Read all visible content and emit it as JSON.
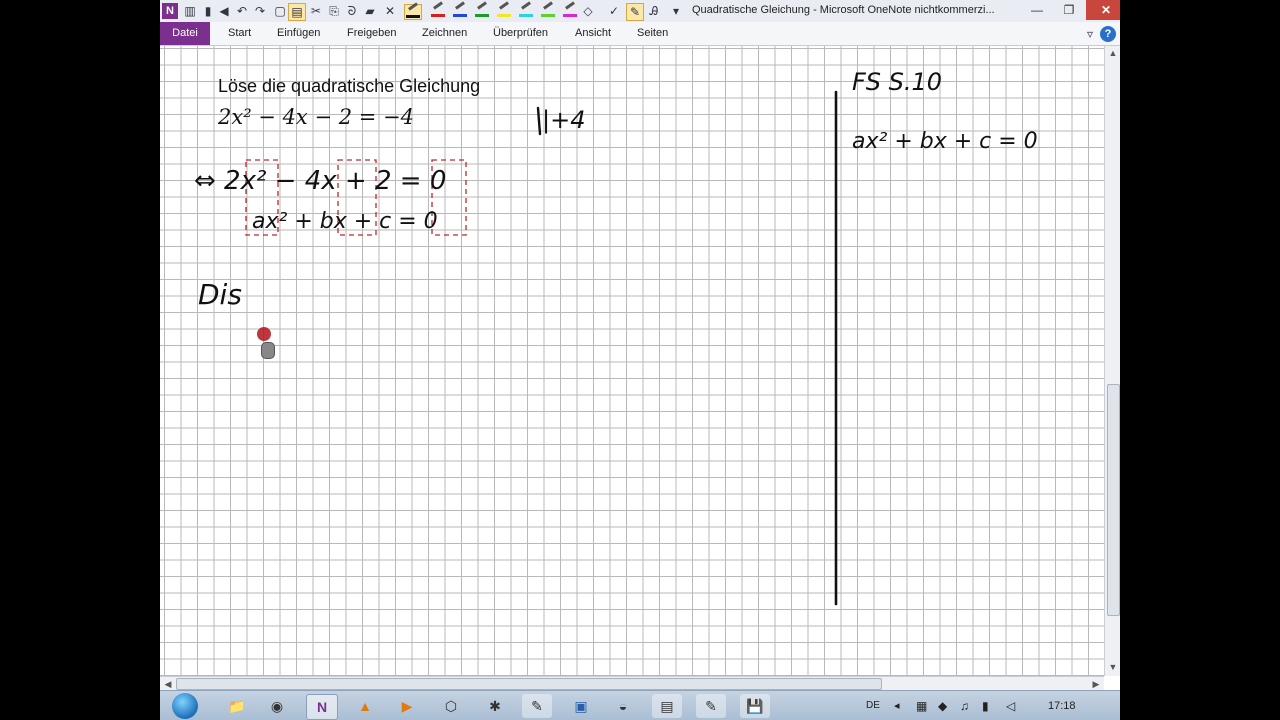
{
  "window": {
    "title": "Quadratische Gleichung - Microsoft OneNote nichtkommerzi...",
    "controls": {
      "minimize": "—",
      "maximize": "❐",
      "close": "✕"
    }
  },
  "ribbon": {
    "tabs": [
      "Datei",
      "Start",
      "Einfügen",
      "Freigeben",
      "Zeichnen",
      "Überprüfen",
      "Ansicht",
      "Seiten"
    ]
  },
  "page": {
    "heading": "Löse die quadratische Gleichung",
    "equation": "2x² − 4x − 2 = −4",
    "ink": {
      "operation": "|+4",
      "line1": "⇔ 2x² − 4x + 2 = 0",
      "line2": "ax² + bx + c = 0",
      "discriminant_start": "Dis",
      "reference": "FS S.10",
      "general_form": "ax² + bx + c = 0"
    }
  },
  "taskbar": {
    "language": "DE",
    "time": "17:18"
  },
  "colors": {
    "ribbon_file_tab": "#7b2f8e",
    "ink": "#111111",
    "highlight_boxes": "#c0262d"
  }
}
